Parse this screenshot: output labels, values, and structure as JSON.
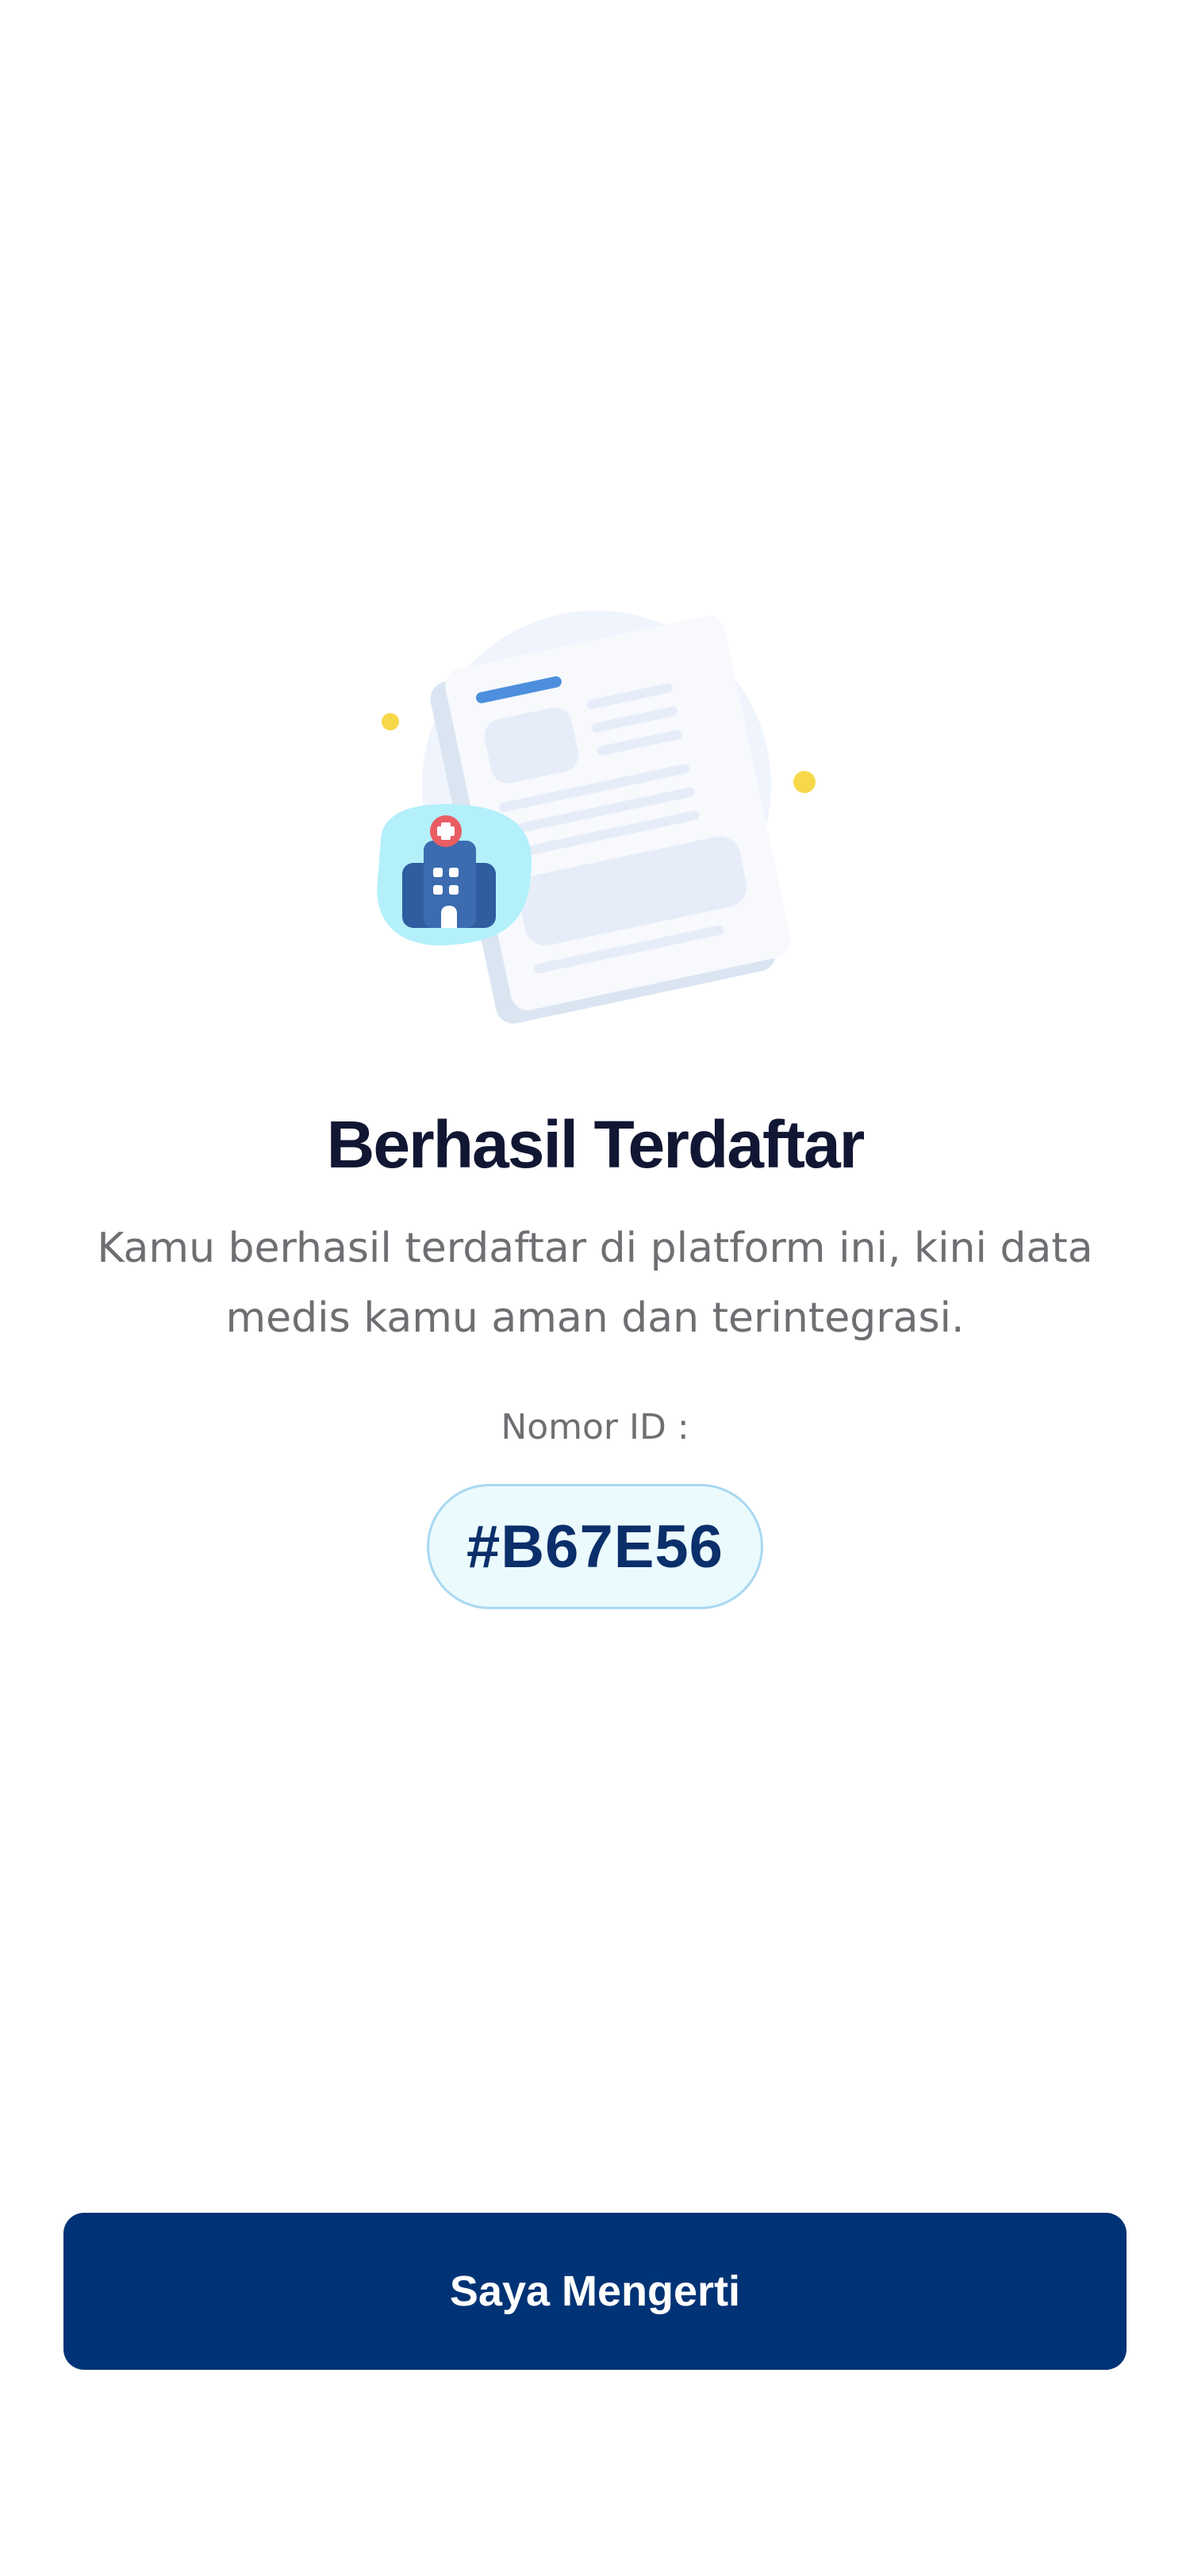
{
  "success": {
    "title": "Berhasil Terdaftar",
    "description": "Kamu berhasil terdaftar di platform ini, kini data medis kamu aman dan terintegrasi.",
    "id_label": "Nomor ID :",
    "id_value": "#B67E56"
  },
  "actions": {
    "confirm_label": "Saya Mengerti"
  },
  "illustration": {
    "icon": "hospital-document-icon",
    "colors": {
      "primary": "#003375",
      "badge_bg": "#b3f0fa",
      "document_bg": "#f3f6fc",
      "cross": "#e95d63",
      "dots": "#f5d442"
    }
  }
}
